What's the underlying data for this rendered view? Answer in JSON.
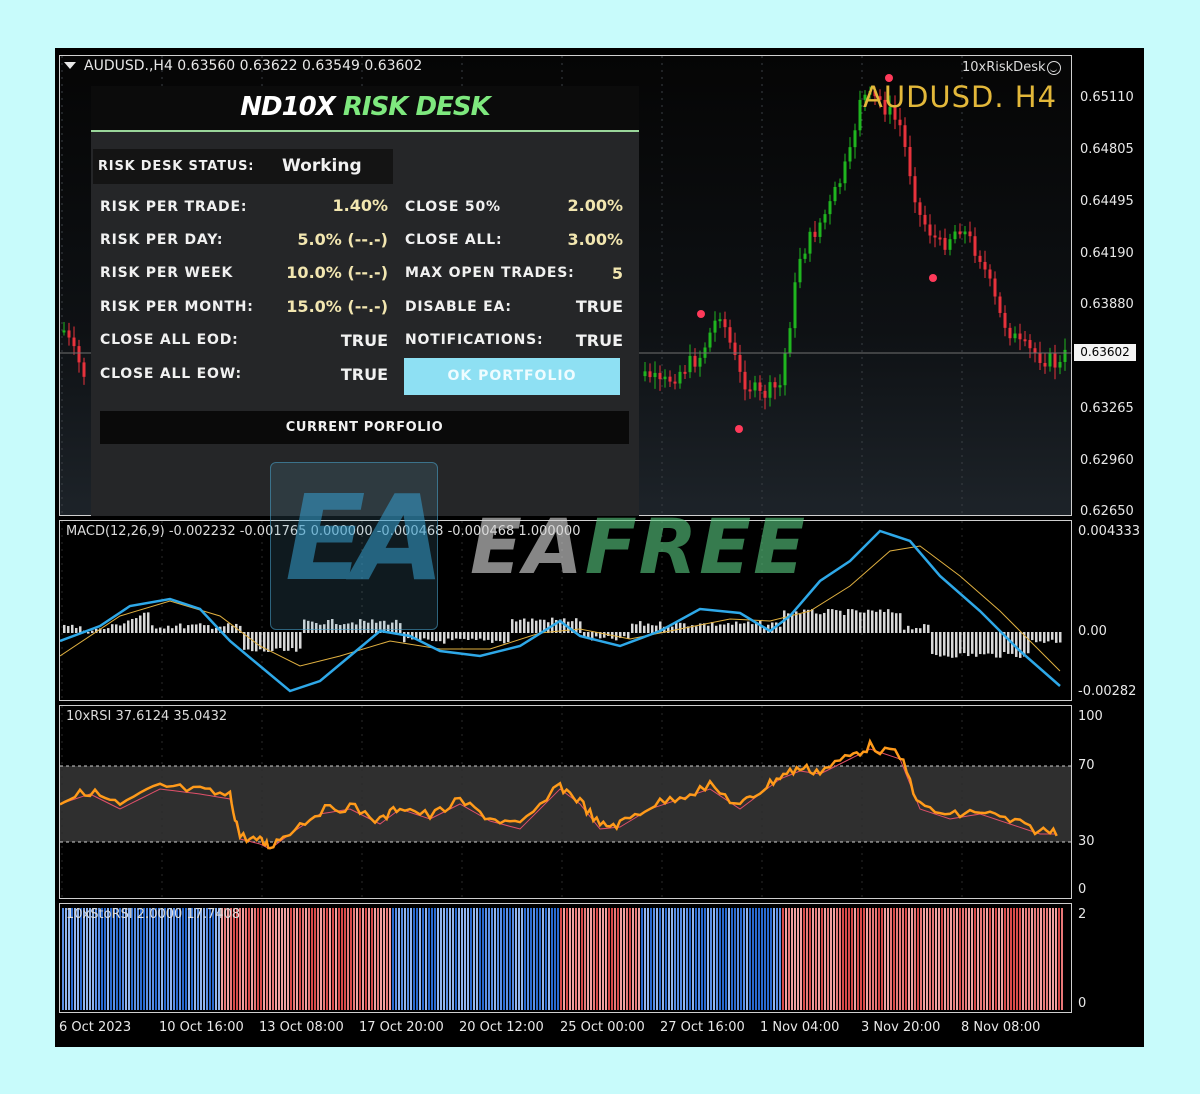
{
  "chart": {
    "symbol_line": "AUDUSD.,H4  0.63560 0.63622 0.63549 0.63602",
    "ea_name": "10xRiskDesk",
    "symbol_big": "AUDUSD. H4",
    "current_price": "0.63602",
    "price_axis": [
      "0.65110",
      "0.64805",
      "0.64495",
      "0.64190",
      "0.63880",
      "0.63265",
      "0.62960",
      "0.62650"
    ],
    "time_axis": [
      "6 Oct 2023",
      "10 Oct 16:00",
      "13 Oct 08:00",
      "17 Oct 20:00",
      "20 Oct 12:00",
      "25 Oct 00:00",
      "27 Oct 16:00",
      "1 Nov 04:00",
      "3 Nov 20:00",
      "8 Nov 08:00"
    ],
    "colors": {
      "bull": "#1fb51f",
      "bear": "#e8323c",
      "macd_line": "#2ea8e8",
      "signal_line": "#e0b040",
      "rsi": "#ff9a1a"
    }
  },
  "panel": {
    "title_a": "ND10X",
    "title_b": "RISK DESK",
    "status_label": "RISK DESK STATUS:",
    "status_value": "Working",
    "rows_left": [
      {
        "label": "RISK PER TRADE:",
        "value": "1.40%"
      },
      {
        "label": "RISK PER DAY:",
        "value": "5.0% (--.-)"
      },
      {
        "label": "RISK PER WEEK",
        "value": "10.0% (--.-)"
      },
      {
        "label": "RISK PER MONTH:",
        "value": "15.0% (--.-)"
      },
      {
        "label": "CLOSE ALL EOD:",
        "value": "TRUE"
      },
      {
        "label": "CLOSE ALL EOW:",
        "value": "TRUE"
      }
    ],
    "rows_right": [
      {
        "label": "CLOSE 50%",
        "value": "2.00%"
      },
      {
        "label": "CLOSE ALL:",
        "value": "3.00%"
      },
      {
        "label": "MAX OPEN TRADES:",
        "value": "5"
      },
      {
        "label": "DISABLE EA:",
        "value": "TRUE"
      },
      {
        "label": "NOTIFICATIONS:",
        "value": "TRUE"
      }
    ],
    "ok_button": "OK PORTFOLIO",
    "current_portfolio": "CURRENT PORFOLIO"
  },
  "macd": {
    "title": "MACD(12,26,9) -0.002232 -0.001765 0.000000 -0.000468 -0.000468 1.000000",
    "axis": [
      "0.004333",
      "0.00",
      "-0.00282"
    ]
  },
  "rsi": {
    "title": "10xRSI 37.6124 35.0432",
    "axis": [
      "100",
      "70",
      "30",
      "0"
    ]
  },
  "storsi": {
    "title": "10xStoRSI 2.0000 17.7408",
    "axis": [
      "2",
      "0"
    ]
  },
  "watermark": {
    "logo": "EA",
    "text_a": "EA",
    "text_b": "FREE"
  }
}
